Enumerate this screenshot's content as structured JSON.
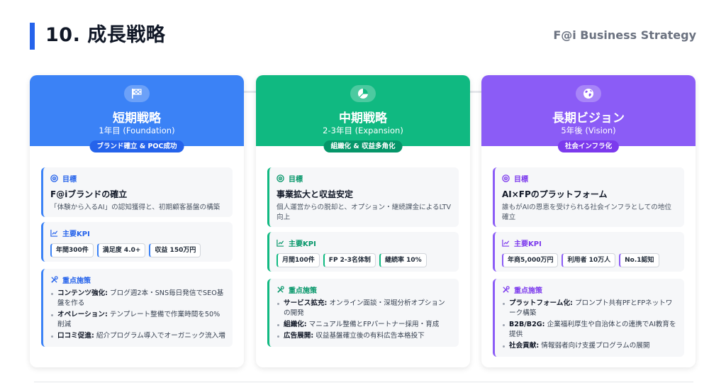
{
  "header": {
    "title": "10. 成長戦略",
    "brand": "F@i Business Strategy",
    "accent": "#2563eb"
  },
  "cards": [
    {
      "color": "#3b82f6",
      "icon": "checkered-flag-icon",
      "title": "短期戦略",
      "subtitle": "1年目 (Foundation)",
      "badge": "ブランド確立 & POC成功",
      "goal_label": "目標",
      "goal_title": "F@iブランドの確立",
      "goal_desc": "「体験から入るAI」の認知獲得と、初期顧客基盤の構築",
      "kpi_label": "主要KPI",
      "kpis": [
        "年間300件",
        "満足度 4.0+",
        "収益 150万円"
      ],
      "measures_label": "重点施策",
      "measures": [
        {
          "bold": "コンテンツ強化:",
          "text": " ブログ週2本・SNS毎日発信でSEO基盤を作る"
        },
        {
          "bold": "オペレーション:",
          "text": " テンプレート整備で作業時間を50%削減"
        },
        {
          "bold": "口コミ促進:",
          "text": " 紹介プログラム導入でオーガニック流入増"
        }
      ]
    },
    {
      "color": "#10b981",
      "icon": "pie-chart-icon",
      "title": "中期戦略",
      "subtitle": "2-3年目 (Expansion)",
      "badge": "組織化 & 収益多角化",
      "goal_label": "目標",
      "goal_title": "事業拡大と収益安定",
      "goal_desc": "個人運営からの脱却と、オプション・継続課金によるLTV向上",
      "kpi_label": "主要KPI",
      "kpis": [
        "月間100件",
        "FP 2-3名体制",
        "継続率 10%"
      ],
      "measures_label": "重点施策",
      "measures": [
        {
          "bold": "サービス拡充:",
          "text": " オンライン面談・深堀分析オプションの開発"
        },
        {
          "bold": "組織化:",
          "text": " マニュアル整備とFPパートナー採用・育成"
        },
        {
          "bold": "広告展開:",
          "text": " 収益基盤確立後の有料広告本格投下"
        }
      ]
    },
    {
      "color": "#8b5cf6",
      "icon": "globe-icon",
      "title": "長期ビジョン",
      "subtitle": "5年後 (Vision)",
      "badge": "社会インフラ化",
      "goal_label": "目標",
      "goal_title": "AI×FPのプラットフォーム",
      "goal_desc": "誰もがAIの恩恵を受けられる社会インフラとしての地位確立",
      "kpi_label": "主要KPI",
      "kpis": [
        "年商5,000万円",
        "利用者 10万人",
        "No.1認知"
      ],
      "measures_label": "重点施策",
      "measures": [
        {
          "bold": "プラットフォーム化:",
          "text": " プロンプト共有PFとFPネットワーク構築"
        },
        {
          "bold": "B2B/B2G:",
          "text": " 企業福利厚生や自治体との連携でAI教育を提供"
        },
        {
          "bold": "社会貢献:",
          "text": " 情報弱者向け支援プログラムの展開"
        }
      ]
    }
  ]
}
